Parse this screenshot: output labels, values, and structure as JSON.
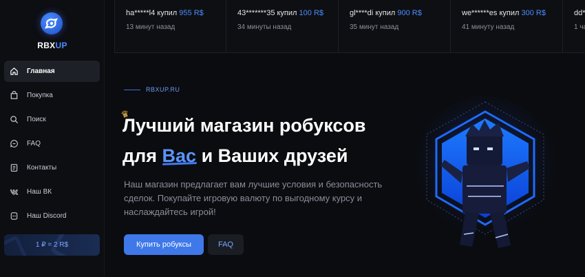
{
  "brand": {
    "part1": "RBX",
    "part2": "UP"
  },
  "nav": [
    {
      "label": "Главная",
      "icon": "home-icon",
      "active": true
    },
    {
      "label": "Покупка",
      "icon": "cart-icon"
    },
    {
      "label": "Поиск",
      "icon": "search-icon"
    },
    {
      "label": "FAQ",
      "icon": "chat-icon"
    },
    {
      "label": "Контакты",
      "icon": "contacts-icon"
    },
    {
      "label": "Наш ВК",
      "icon": "vk-icon"
    },
    {
      "label": "Наш Discord",
      "icon": "discord-icon"
    }
  ],
  "rate": "1 ₽ = 2 R$",
  "ticker": [
    {
      "user": "ha*****l4",
      "verb": "купил",
      "amount": "955 R$",
      "time": "13 минут назад"
    },
    {
      "user": "43*******35",
      "verb": "купил",
      "amount": "100 R$",
      "time": "34 минуты назад"
    },
    {
      "user": "gl****di",
      "verb": "купил",
      "amount": "900 R$",
      "time": "35 минут назад"
    },
    {
      "user": "we******es",
      "verb": "купил",
      "amount": "300 R$",
      "time": "41 минуту назад"
    },
    {
      "user": "dd*",
      "verb": "",
      "amount": "",
      "time": "1 ча"
    }
  ],
  "hero": {
    "tag": "RBXUP.RU",
    "title_line1": "Лучший магазин робуксов",
    "title_line2_pre": "для ",
    "title_line2_hl": "Вас",
    "title_line2_post": " и Ваших друзей",
    "description": "Наш магазин предлагает вам лучшие условия и безопасность сделок. Покупайте игровую валюту по выгодному курсу и наслаждайтесь игрой!",
    "buy_label": "Купить робуксы",
    "faq_label": "FAQ"
  },
  "colors": {
    "accent": "#3e78e9",
    "background": "#0b0c10",
    "highlight": "#5a95ff"
  }
}
